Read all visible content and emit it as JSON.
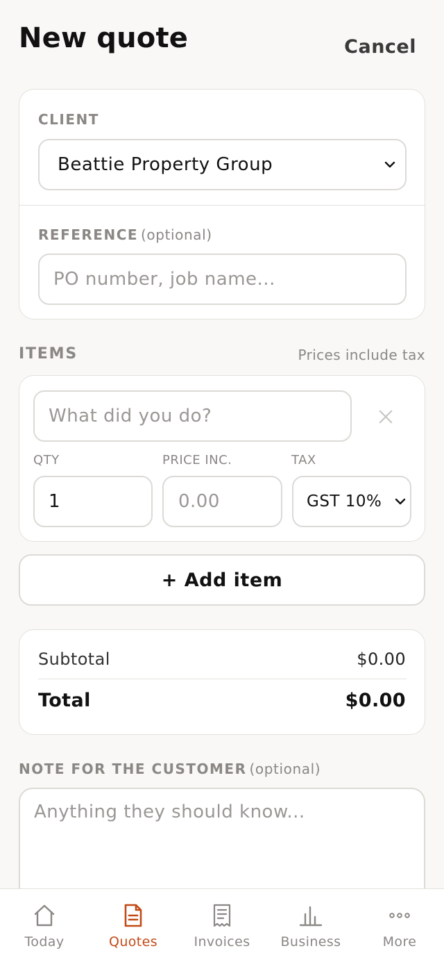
{
  "header": {
    "title": "New quote",
    "cancel_label": "Cancel"
  },
  "client": {
    "label": "CLIENT",
    "selected": "Beattie Property Group"
  },
  "reference": {
    "label": "REFERENCE",
    "optional": "(optional)",
    "placeholder": "PO number, job name..."
  },
  "items": {
    "label": "ITEMS",
    "note": "Prices include tax",
    "rows": [
      {
        "description_placeholder": "What did you do?",
        "qty_label": "QTY",
        "qty_value": "1",
        "price_label": "PRICE INC.",
        "price_placeholder": "0.00",
        "tax_label": "TAX",
        "tax_value": "GST 10%"
      }
    ],
    "add_label": "+ Add item"
  },
  "totals": {
    "subtotal_label": "Subtotal",
    "subtotal_value": "$0.00",
    "total_label": "Total",
    "total_value": "$0.00"
  },
  "note": {
    "label": "NOTE FOR THE CUSTOMER",
    "optional": "(optional)",
    "placeholder": "Anything they should know..."
  },
  "tabs": [
    {
      "label": "Today",
      "icon": "house-icon",
      "active": false
    },
    {
      "label": "Quotes",
      "icon": "document-icon",
      "active": true
    },
    {
      "label": "Invoices",
      "icon": "receipt-icon",
      "active": false
    },
    {
      "label": "Business",
      "icon": "bar-chart-icon",
      "active": false
    },
    {
      "label": "More",
      "icon": "more-dots-icon",
      "active": false
    }
  ],
  "colors": {
    "accent": "#c24a16",
    "muted": "#8a8784",
    "background": "#f9f8f6"
  }
}
